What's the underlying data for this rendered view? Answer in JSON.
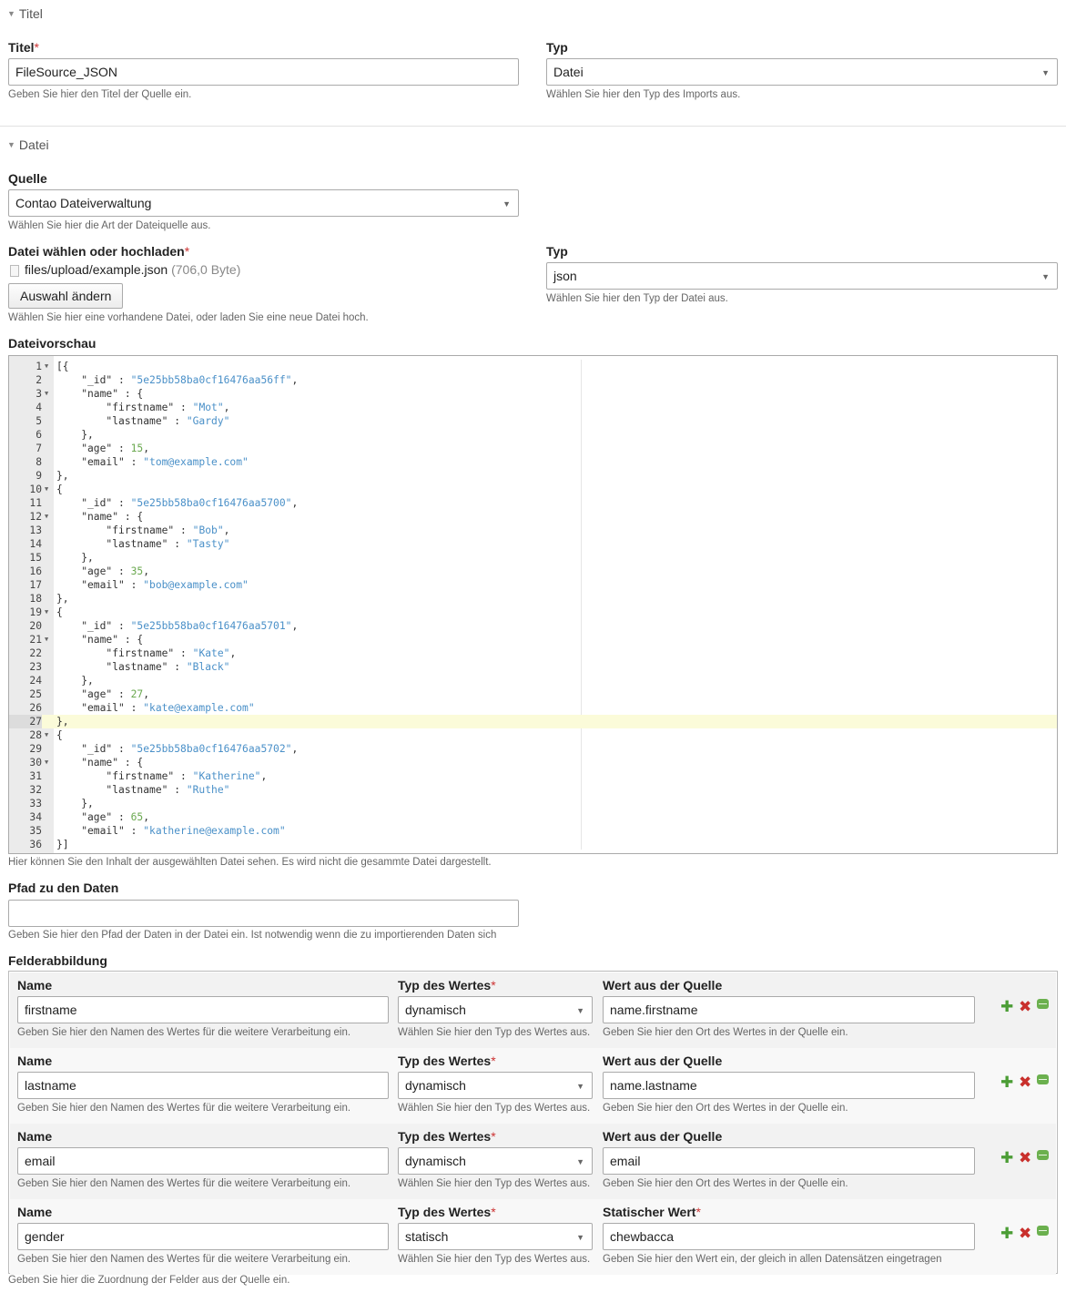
{
  "sections": {
    "title_legend": "Titel",
    "file_legend": "Datei"
  },
  "title_field": {
    "label": "Titel",
    "required_mark": "*",
    "value": "FileSource_JSON",
    "help": "Geben Sie hier den Titel der Quelle ein."
  },
  "type_field": {
    "label": "Typ",
    "value": "Datei",
    "help": "Wählen Sie hier den Typ des Imports aus."
  },
  "source_field": {
    "label": "Quelle",
    "value": "Contao Dateiverwaltung",
    "help": "Wählen Sie hier die Art der Dateiquelle aus."
  },
  "file_field": {
    "label": "Datei wählen oder hochladen",
    "required_mark": "*",
    "path": "files/upload/example.json",
    "size": "(706,0 Byte)",
    "button": "Auswahl ändern",
    "help": "Wählen Sie hier eine vorhandene Datei, oder laden Sie eine neue Datei hoch."
  },
  "filetype_field": {
    "label": "Typ",
    "value": "json",
    "help": "Wählen Sie hier den Typ der Datei aus."
  },
  "preview": {
    "label": "Dateivorschau",
    "help": "Hier können Sie den Inhalt der ausgewählten Datei sehen. Es wird nicht die gesammte Datei dargestellt.",
    "highlight_line": 27,
    "lines": [
      "[{",
      "    \"_id\" : \"5e25bb58ba0cf16476aa56ff\",",
      "    \"name\" : {",
      "        \"firstname\" : \"Mot\",",
      "        \"lastname\" : \"Gardy\"",
      "    },",
      "    \"age\" : 15,",
      "    \"email\" : \"tom@example.com\"",
      "},",
      "{",
      "    \"_id\" : \"5e25bb58ba0cf16476aa5700\",",
      "    \"name\" : {",
      "        \"firstname\" : \"Bob\",",
      "        \"lastname\" : \"Tasty\"",
      "    },",
      "    \"age\" : 35,",
      "    \"email\" : \"bob@example.com\"",
      "},",
      "{",
      "    \"_id\" : \"5e25bb58ba0cf16476aa5701\",",
      "    \"name\" : {",
      "        \"firstname\" : \"Kate\",",
      "        \"lastname\" : \"Black\"",
      "    },",
      "    \"age\" : 27,",
      "    \"email\" : \"kate@example.com\"",
      "},",
      "{",
      "    \"_id\" : \"5e25bb58ba0cf16476aa5702\",",
      "    \"name\" : {",
      "        \"firstname\" : \"Katherine\",",
      "        \"lastname\" : \"Ruthe\"",
      "    },",
      "    \"age\" : 65,",
      "    \"email\" : \"katherine@example.com\"",
      "}]"
    ],
    "fold_lines": [
      1,
      3,
      10,
      12,
      19,
      21,
      28,
      30
    ]
  },
  "data_path": {
    "label": "Pfad zu den Daten",
    "value": "",
    "help": "Geben Sie hier den Pfad der Daten in der Datei ein. Ist notwendig wenn die zu importierenden Daten sich"
  },
  "mapping": {
    "label": "Felderabbildung",
    "help": "Geben Sie hier die Zuordnung der Felder aus der Quelle ein.",
    "rows": [
      {
        "name_label": "Name",
        "name_value": "firstname",
        "name_help": "Geben Sie hier den Namen des Wertes für die weitere Verarbeitung ein.",
        "type_label": "Typ des Wertes",
        "type_value": "dynamisch",
        "type_help": "Wählen Sie hier den Typ des Wertes aus.",
        "value_label": "Wert aus der Quelle",
        "value_value": "name.firstname",
        "value_help": "Geben Sie hier den Ort des Wertes in der Quelle ein."
      },
      {
        "name_label": "Name",
        "name_value": "lastname",
        "name_help": "Geben Sie hier den Namen des Wertes für die weitere Verarbeitung ein.",
        "type_label": "Typ des Wertes",
        "type_value": "dynamisch",
        "type_help": "Wählen Sie hier den Typ des Wertes aus.",
        "value_label": "Wert aus der Quelle",
        "value_value": "name.lastname",
        "value_help": "Geben Sie hier den Ort des Wertes in der Quelle ein."
      },
      {
        "name_label": "Name",
        "name_value": "email",
        "name_help": "Geben Sie hier den Namen des Wertes für die weitere Verarbeitung ein.",
        "type_label": "Typ des Wertes",
        "type_value": "dynamisch",
        "type_help": "Wählen Sie hier den Typ des Wertes aus.",
        "value_label": "Wert aus der Quelle",
        "value_value": "email",
        "value_help": "Geben Sie hier den Ort des Wertes in der Quelle ein."
      },
      {
        "name_label": "Name",
        "name_value": "gender",
        "name_help": "Geben Sie hier den Namen des Wertes für die weitere Verarbeitung ein.",
        "type_label": "Typ des Wertes",
        "type_value": "statisch",
        "type_help": "Wählen Sie hier den Typ des Wertes aus.",
        "value_label": "Statischer Wert",
        "value_value": "chewbacca",
        "value_help": "Geben Sie hier den Wert ein, der gleich in allen Datensätzen eingetragen",
        "value_required": true
      }
    ],
    "icons": {
      "add": "plus-icon",
      "delete": "delete-icon",
      "drag": "drag-handle-icon"
    },
    "colors": {
      "add": "#4b9d35",
      "delete": "#c9302c",
      "drag": "#6bb04e"
    }
  }
}
